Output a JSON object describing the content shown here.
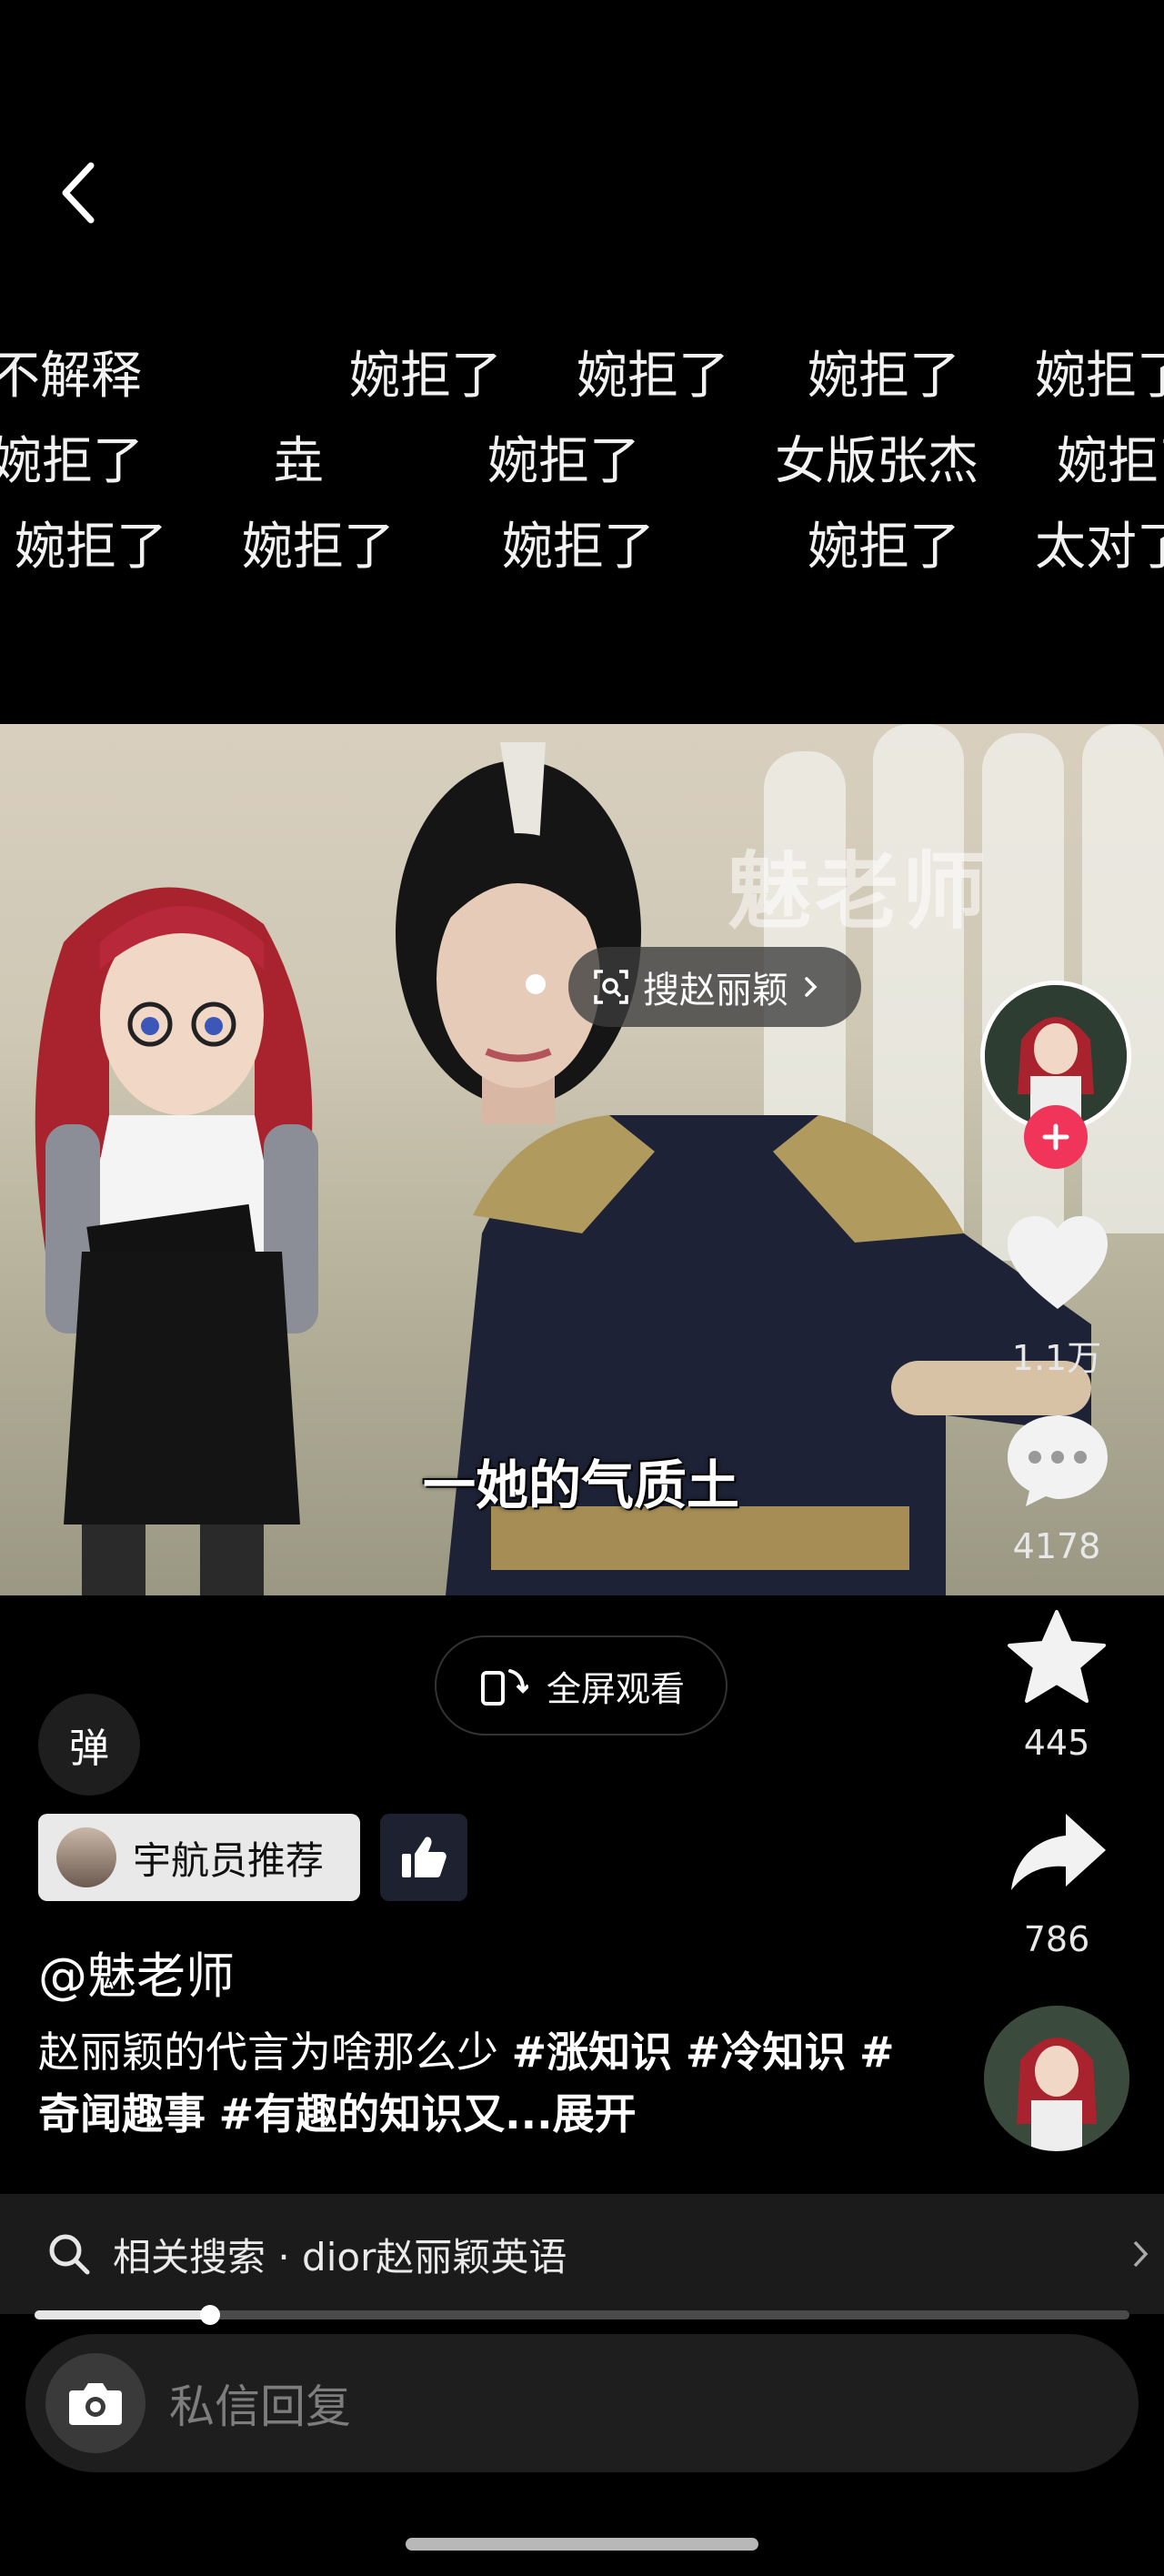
{
  "nav": {
    "back_icon": "chevron-left-icon"
  },
  "danmaku": [
    [
      "不解释",
      "婉拒了",
      "婉拒了",
      "婉拒了",
      "婉拒了"
    ],
    [
      "婉拒了",
      "垚",
      "婉拒了",
      "女版张杰",
      "婉拒了"
    ],
    [
      "婉拒了",
      "婉拒了",
      "婉拒了",
      "婉拒了",
      "太对了"
    ]
  ],
  "video": {
    "watermark": "魅老师",
    "search_chip": "搜赵丽颖",
    "subtitle": "一她的气质土"
  },
  "rail": {
    "likes": "1.1万",
    "comments": "4178",
    "favorites": "445",
    "shares": "786"
  },
  "controls": {
    "fullscreen_label": "全屏观看",
    "danmaku_toggle": "弹"
  },
  "recommendation": {
    "label": "宇航员推荐"
  },
  "post": {
    "author": "@魅老师",
    "description": "赵丽颖的代言为啥那么少",
    "tags": [
      "#涨知识",
      "#冷知识",
      "#奇闻趣事",
      "#有趣的知识又..."
    ],
    "expand": "展开"
  },
  "related_search": {
    "label": "相关搜索 · dior赵丽颖英语"
  },
  "playback": {
    "progress": 0.16
  },
  "reply": {
    "placeholder": "私信回复"
  },
  "colors": {
    "follow": "#f0345a",
    "background": "#000000"
  }
}
